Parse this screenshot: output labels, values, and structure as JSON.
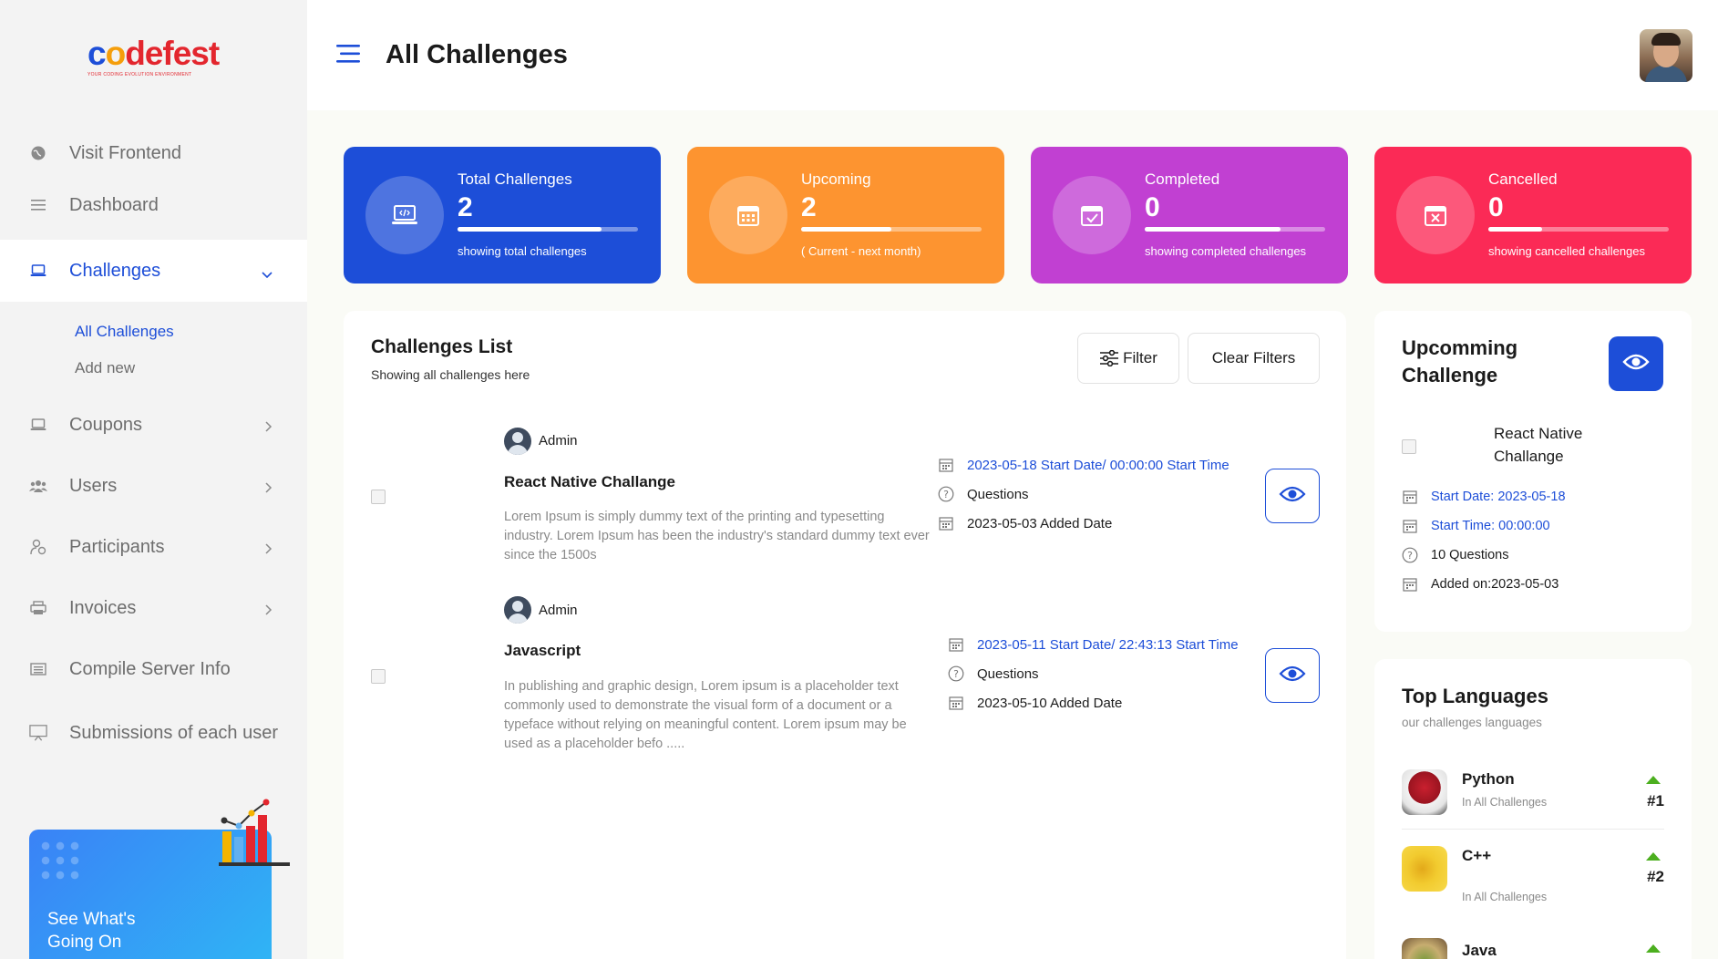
{
  "app": {
    "logo_text": "codefest",
    "logo_tagline": "YOUR CODING EVOLUTION ENVIRONMENT"
  },
  "header": {
    "title": "All Challenges"
  },
  "sidebar": {
    "items": [
      {
        "label": "Visit Frontend",
        "icon": "globe-icon"
      },
      {
        "label": "Dashboard",
        "icon": "list-icon"
      },
      {
        "label": "Challenges",
        "icon": "laptop-icon",
        "active": true
      },
      {
        "label": "Coupons",
        "icon": "laptop-icon"
      },
      {
        "label": "Users",
        "icon": "users-icon"
      },
      {
        "label": "Participants",
        "icon": "participants-icon"
      },
      {
        "label": "Invoices",
        "icon": "printer-icon"
      },
      {
        "label": "Compile Server Info",
        "icon": "server-icon"
      },
      {
        "label": "Submissions of each user",
        "icon": "monitor-icon"
      }
    ],
    "sub_items": [
      {
        "label": "All Challenges",
        "active": true
      },
      {
        "label": "Add new"
      }
    ],
    "promo": {
      "text_line1": "See What's",
      "text_line2": "Going On"
    }
  },
  "stats": [
    {
      "label": "Total Challenges",
      "value": "2",
      "note": "showing total challenges",
      "color": "#1d4ed8",
      "progress": 0.8
    },
    {
      "label": "Upcoming",
      "value": "2",
      "note": "( Current - next month)",
      "color": "#fd9430",
      "progress": 0.5
    },
    {
      "label": "Completed",
      "value": "0",
      "note": "showing completed challenges",
      "color": "#c140d2",
      "progress": 0.75
    },
    {
      "label": "Cancelled",
      "value": "0",
      "note": "showing cancelled challenges",
      "color": "#fb2a56",
      "progress": 0.3
    }
  ],
  "challenges_list": {
    "title": "Challenges List",
    "subtitle": "Showing all challenges here",
    "filter_label": "Filter",
    "clear_label": "Clear Filters",
    "items": [
      {
        "author": "Admin",
        "title": "React Native Challange",
        "description": "Lorem Ipsum is simply dummy text of the printing and typesetting industry. Lorem Ipsum has been the industry's standard dummy text ever since the 1500s",
        "start": "2023-05-18 Start Date/ 00:00:00 Start Time",
        "questions": "Questions",
        "added": "2023-05-03 Added Date"
      },
      {
        "author": "Admin",
        "title": "Javascript",
        "description": "In publishing and graphic design, Lorem ipsum is a placeholder text commonly used to demonstrate the visual form of a document or a typeface without relying on meaningful content. Lorem ipsum may be used as a placeholder befo .....",
        "start": "2023-05-11 Start Date/ 22:43:13 Start Time",
        "questions": "Questions",
        "added": "2023-05-10 Added Date"
      }
    ]
  },
  "upcoming": {
    "title": "Upcomming Challenge",
    "name": "React Native Challange",
    "start_date": "Start Date: 2023-05-18",
    "start_time": "Start Time: 00:00:00",
    "questions": "10 Questions",
    "added": "Added on:2023-05-03"
  },
  "top_languages": {
    "title": "Top Languages",
    "subtitle": "our challenges languages",
    "items": [
      {
        "name": "Python",
        "meta": "In All Challenges",
        "rank": "#1"
      },
      {
        "name": "C++",
        "meta": "In All Challenges",
        "rank": "#2"
      },
      {
        "name": "Java",
        "meta": "",
        "rank": ""
      }
    ]
  }
}
